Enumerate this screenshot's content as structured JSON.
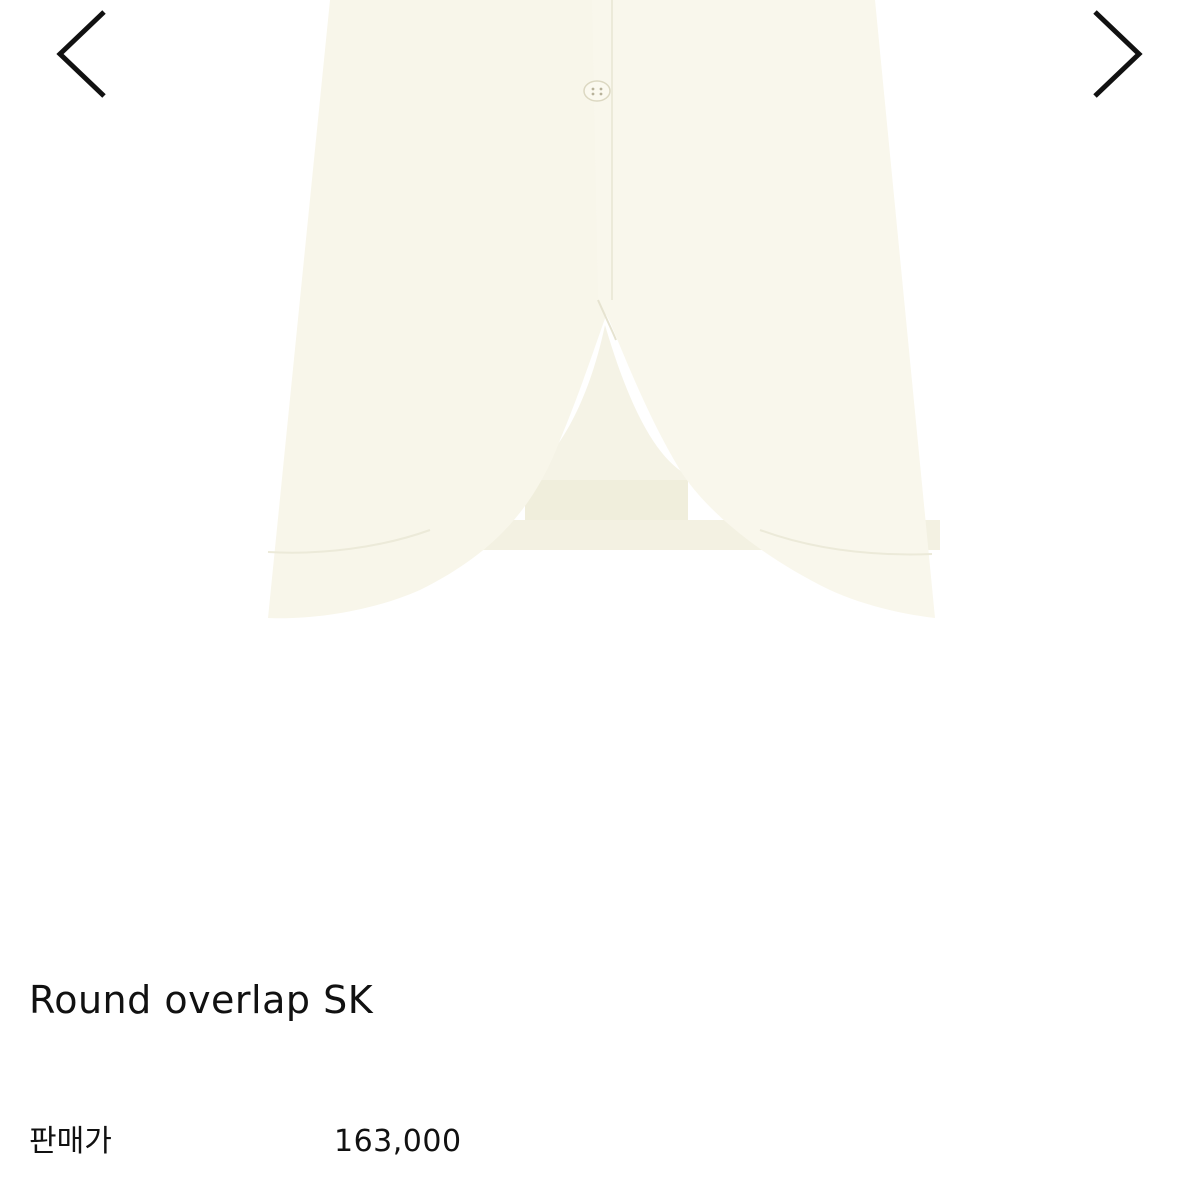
{
  "gallery": {
    "prev_icon": "chevron-left-icon",
    "next_icon": "chevron-right-icon",
    "image_subject": "ivory skirt",
    "colors": {
      "garment": "#f8f6ea",
      "garment_shadow": "#ecead9",
      "lining": "#f3f1e2",
      "arrow": "#111111"
    }
  },
  "product": {
    "name": "Round overlap SK",
    "price_label": "판매가",
    "price_value": "163,000"
  }
}
